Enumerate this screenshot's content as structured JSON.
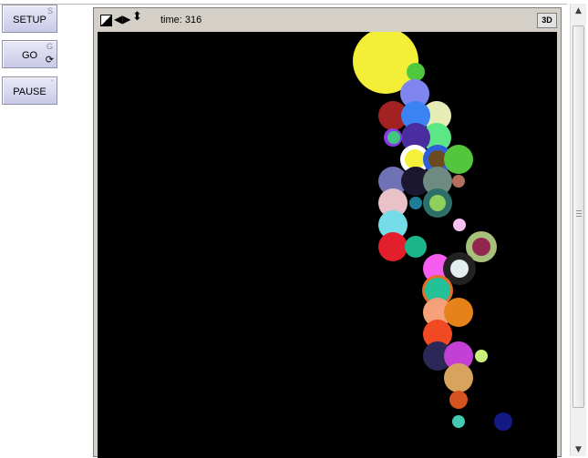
{
  "buttons": {
    "setup": {
      "label": "SETUP",
      "key": "S"
    },
    "go": {
      "label": "GO",
      "key": "G",
      "forever_icon": "loop-icon"
    },
    "pause": {
      "label": "PAUSE",
      "key": "'"
    }
  },
  "view": {
    "tick_text": "time: 316",
    "three_d_label": "3D",
    "icons": [
      "edit-shape-icon",
      "resize-horizontal-icon",
      "resize-vertical-icon"
    ],
    "background": "#000000"
  },
  "agents": [
    {
      "color": "#f3ee37",
      "size": "xl"
    },
    {
      "color": "#4ec83c",
      "size": "s"
    },
    {
      "color": "#7f86ef",
      "size": "m"
    },
    {
      "color": "#e6ecb5",
      "size": "m"
    },
    {
      "color": "#a32120",
      "size": "m"
    },
    {
      "color": "#3b83f2",
      "size": "m"
    },
    {
      "color": "#5be785",
      "size": "m"
    },
    {
      "color": "#4a2d9f",
      "size": "m"
    },
    {
      "color": "#8a3be8",
      "size": "s"
    },
    {
      "color": "#42c87e",
      "size": "xs"
    },
    {
      "color": "#ffffff",
      "size": "m"
    },
    {
      "color": "#f4f13c",
      "size": "s"
    },
    {
      "color": "#2e5fd8",
      "size": "m"
    },
    {
      "color": "#6a4a1e",
      "size": "s"
    },
    {
      "color": "#54c63d",
      "size": "m"
    },
    {
      "color": "#6f72b4",
      "size": "m"
    },
    {
      "color": "#1c1730",
      "size": "m"
    },
    {
      "color": "#6f8a80",
      "size": "m"
    },
    {
      "color": "#b56f5f",
      "size": "xs"
    },
    {
      "color": "#e8c2c8",
      "size": "m"
    },
    {
      "color": "#1e7d96",
      "size": "xs"
    },
    {
      "color": "#2e6f6a",
      "size": "m"
    },
    {
      "color": "#8ed05c",
      "size": "s"
    },
    {
      "color": "#f6c0f0",
      "size": "xs"
    },
    {
      "color": "#74dde8",
      "size": "m"
    },
    {
      "color": "#e21f2a",
      "size": "m"
    },
    {
      "color": "#1bb58a",
      "size": "m"
    },
    {
      "color": "#a7c17b",
      "size": "m"
    },
    {
      "color": "#92264e",
      "size": "s"
    },
    {
      "color": "#f65cee",
      "size": "m"
    },
    {
      "color": "#222222",
      "size": "m"
    },
    {
      "color": "#e4eded",
      "size": "s"
    },
    {
      "color": "#e56f24",
      "size": "m"
    },
    {
      "color": "#24c198",
      "size": "m"
    },
    {
      "color": "#f7a17b",
      "size": "m"
    },
    {
      "color": "#e5821a",
      "size": "m"
    },
    {
      "color": "#f14a22",
      "size": "m"
    },
    {
      "color": "#2b2756",
      "size": "m"
    },
    {
      "color": "#c340d4",
      "size": "m"
    },
    {
      "color": "#c9f07b",
      "size": "xs"
    },
    {
      "color": "#d7a45d",
      "size": "m"
    },
    {
      "color": "#d4531f",
      "size": "s"
    },
    {
      "color": "#42cbb1",
      "size": "xs"
    },
    {
      "color": "#131a86",
      "size": "s"
    }
  ]
}
